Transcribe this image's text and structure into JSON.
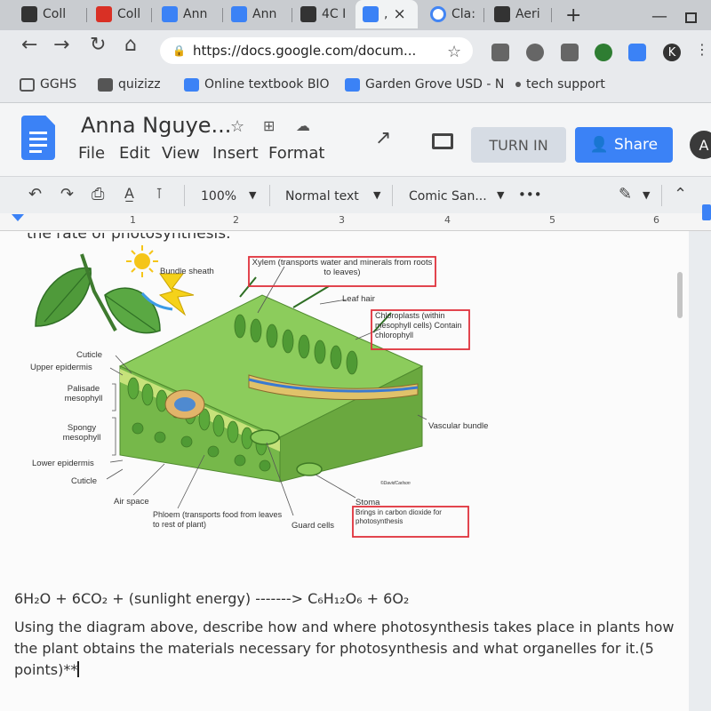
{
  "browser": {
    "tabs": [
      {
        "label": "Coll",
        "icon_color": "#333333"
      },
      {
        "label": "Coll",
        "icon_color": "#d93025"
      },
      {
        "label": "Ann",
        "icon_color": "#3b82f6"
      },
      {
        "label": "Ann",
        "icon_color": "#3b82f6"
      },
      {
        "label": "4C I",
        "icon_color": "#333333"
      },
      {
        "label": ",",
        "icon_color": "#3b82f6",
        "close": "×"
      },
      {
        "label": "Cla:",
        "icon_color": "#4285f4"
      },
      {
        "label": "Aeri",
        "icon_color": "#333333"
      }
    ],
    "new_tab": "+",
    "url": "https://docs.google.com/docum...",
    "bookmarks": [
      {
        "label": "GGHS",
        "icon_color": "#555555"
      },
      {
        "label": "quizizz",
        "icon_color": "#555555"
      },
      {
        "label": "Online textbook BIO",
        "icon_color": "#3b82f6"
      },
      {
        "label": "Garden Grove USD - N",
        "icon_color": "#3b82f6"
      },
      {
        "label": "tech support",
        "icon_color": "#555555"
      }
    ],
    "extensions": [
      "#666666",
      "#666666",
      "#666666",
      "#2e7d32",
      "#3b82f6",
      "#333333"
    ],
    "profile_letter": "K"
  },
  "docs": {
    "title": "Anna Nguye...",
    "menus": [
      "File",
      "Edit",
      "View",
      "Insert",
      "Format"
    ],
    "turn_in_label": "TURN IN",
    "share_label": "Share",
    "avatar_letter": "A",
    "toolbar": {
      "zoom": "100%",
      "style": "Normal text",
      "font": "Comic San..."
    },
    "ruler_numbers": [
      "1",
      "2",
      "3",
      "4",
      "5",
      "6"
    ],
    "accent_color": "#3b82f6"
  },
  "document": {
    "cut_heading": "the rate of photosynthesis.",
    "diagram": {
      "labels": {
        "bundle_sheath": "Bundle sheath",
        "xylem": "Xylem (transports water and minerals from roots to leaves)",
        "leaf_hair": "Leaf hair",
        "chloroplasts": "Chloroplasts (within mesophyll cells) Contain chlorophyll",
        "cuticle_top": "Cuticle",
        "upper_epidermis": "Upper epidermis",
        "palisade": "Palisade mesophyll",
        "spongy": "Spongy mesophyll",
        "lower_epidermis": "Lower epidermis",
        "cuticle_bottom": "Cuticle",
        "vascular": "Vascular bundle",
        "air_space": "Air space",
        "phloem": "Phloem (transports food from leaves to rest of plant)",
        "guard_cells": "Guard cells",
        "stoma": "Stoma",
        "carbon": "Brings in carbon dioxide for photosynthesis",
        "credit": "©DavidCarlson"
      }
    },
    "equation": "6H₂O + 6CO₂ + (sunlight energy) -------> C₆H₁₂O₆ + 6O₂",
    "question": "Using the diagram above, describe how and where photosynthesis takes place in plants how the plant obtains the materials necessary for photosynthesis and what organelles for it.(5 points)**"
  }
}
